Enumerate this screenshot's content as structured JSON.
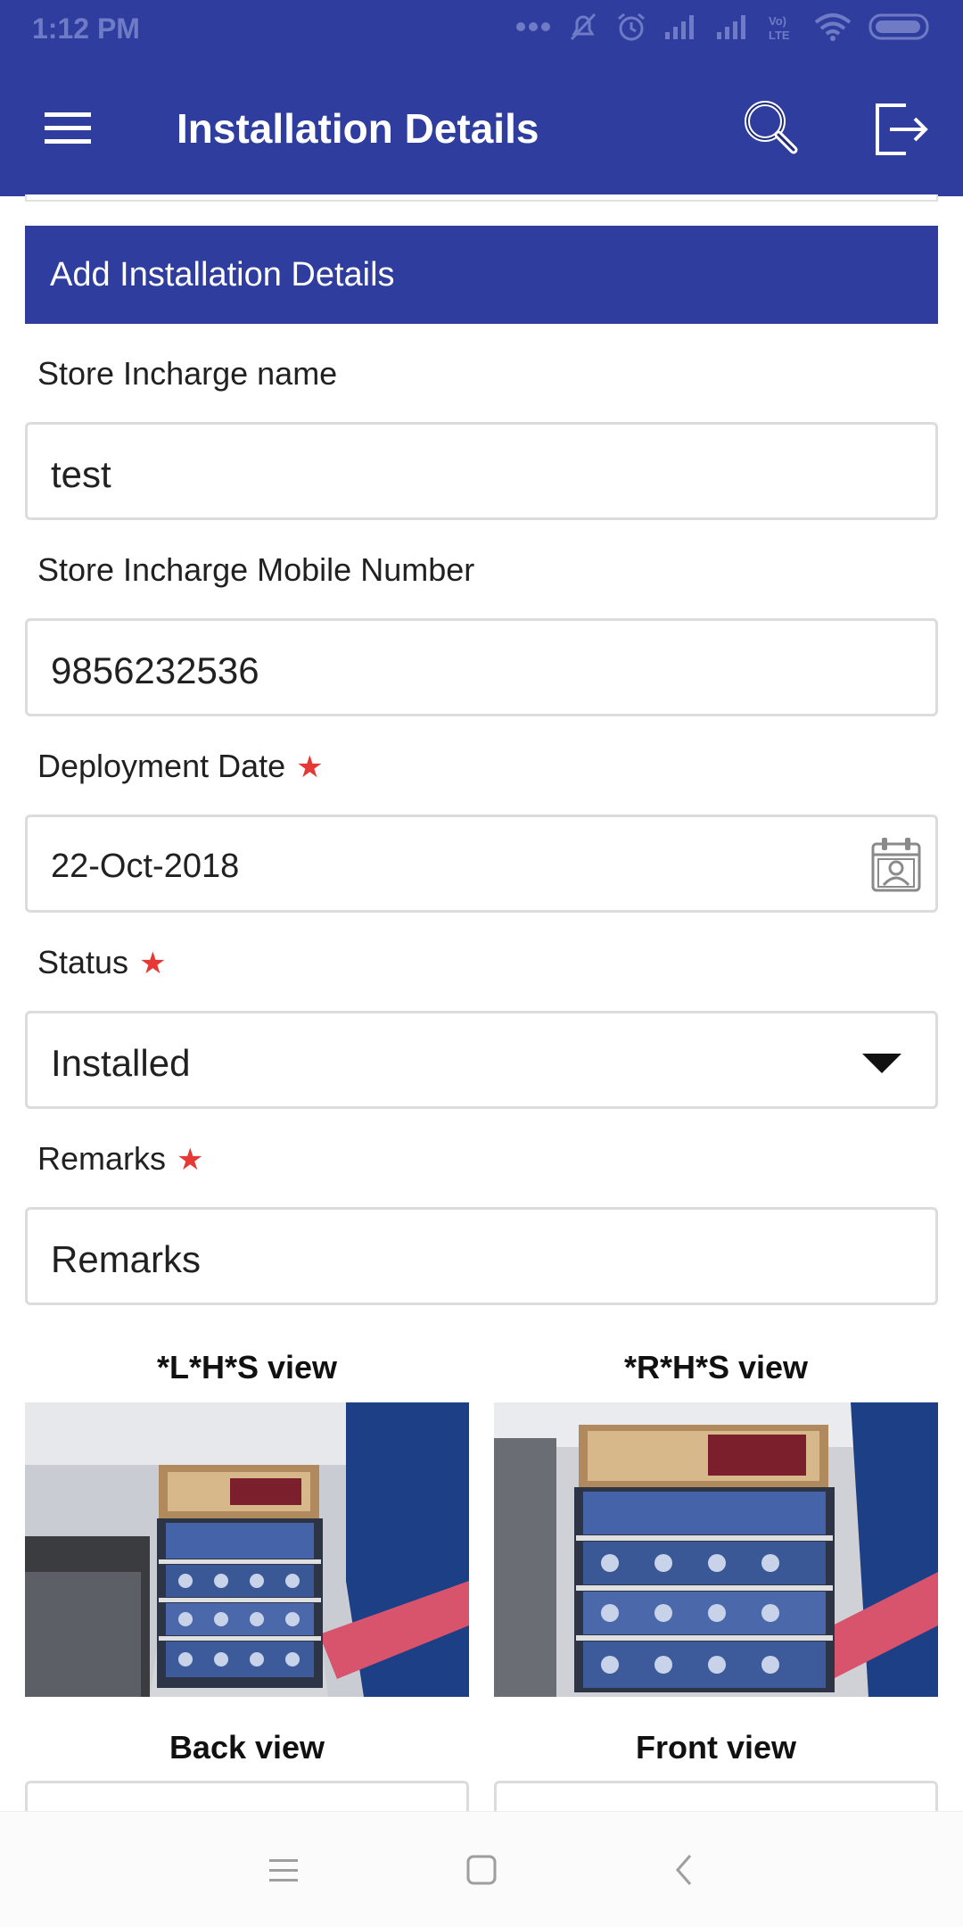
{
  "status_bar": {
    "time": "1:12 PM",
    "icons": [
      "more-dots-icon",
      "mute-icon",
      "alarm-icon",
      "signal-icon",
      "signal-icon",
      "volte-icon",
      "wifi-icon",
      "battery-icon"
    ]
  },
  "app_bar": {
    "title": "Installation Details",
    "icons": [
      "hamburger-menu-icon",
      "search-icon",
      "logout-icon"
    ],
    "color": "#2f3e9e"
  },
  "section": {
    "title": "Add Installation Details"
  },
  "form": {
    "store_incharge_name": {
      "label": "Store Incharge name",
      "value": "test"
    },
    "store_incharge_mobile": {
      "label": "Store Incharge Mobile Number",
      "value": "9856232536"
    },
    "deployment_date": {
      "label": "Deployment Date",
      "required_mark": "★",
      "value": "22-Oct-2018"
    },
    "status": {
      "label": "Status",
      "required_mark": "★",
      "value": "Installed"
    },
    "remarks": {
      "label": "Remarks",
      "required_mark": "★",
      "placeholder": "Remarks"
    }
  },
  "photos": {
    "lhs_label": "*L*H*S view",
    "rhs_label": "*R*H*S view",
    "back_label": "Back view",
    "front_label": "Front view"
  },
  "nav_bar": {
    "icons": [
      "recent-apps-icon",
      "home-icon",
      "back-icon"
    ]
  },
  "colors": {
    "primary": "#2f3e9e",
    "required": "#e53935",
    "border": "#dcdcdc"
  }
}
